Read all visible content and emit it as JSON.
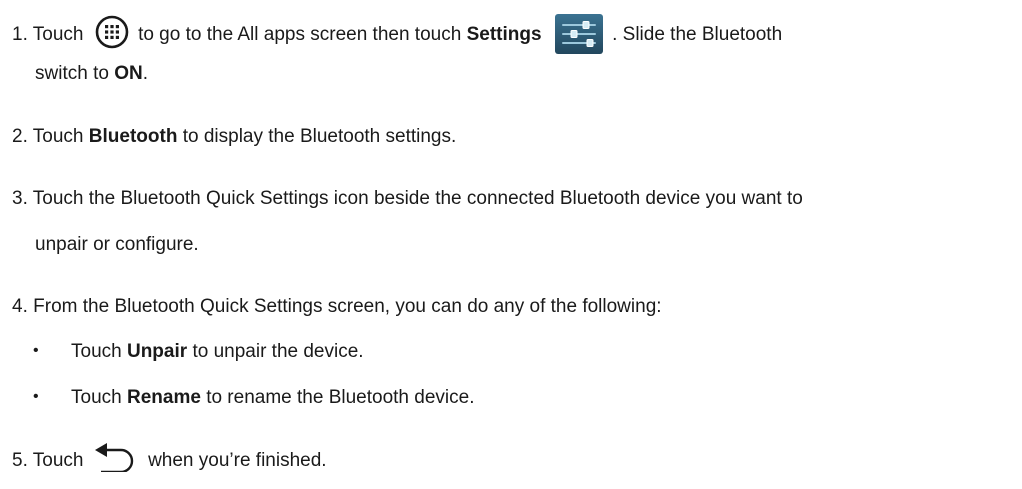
{
  "steps": [
    {
      "num": "1.",
      "t1": "Touch",
      "t2": "to go to the All apps screen then touch",
      "b1": "Settings",
      "t3": ". Slide the Bluetooth",
      "t4": "switch to",
      "b2": "ON",
      "t5": "."
    },
    {
      "num": "2.",
      "t1": "Touch",
      "b1": "Bluetooth",
      "t2": "to display the Bluetooth settings."
    },
    {
      "num": "3.",
      "t1": "Touch the Bluetooth Quick Settings icon beside the connected Bluetooth device you want to",
      "t2": "unpair or configure."
    },
    {
      "num": "4.",
      "t1": "From the Bluetooth Quick Settings screen, you can do any of the following:"
    },
    {
      "num": "5.",
      "t1": "Touch",
      "t2": "when you’re finished."
    }
  ],
  "bullets": [
    {
      "mark": "•",
      "t1": "Touch",
      "b1": "Unpair",
      "t2": "to unpair the device."
    },
    {
      "mark": "•",
      "t1": "Touch",
      "b1": "Rename",
      "t2": "to rename the Bluetooth device."
    }
  ],
  "icons": {
    "all_apps": "all-apps-icon",
    "settings": "settings-icon",
    "back": "back-arrow-icon"
  },
  "colors": {
    "text": "#1a1a1a",
    "settings_icon_bg": "#2e5f7a",
    "settings_icon_slider": "#9cc8dc"
  }
}
